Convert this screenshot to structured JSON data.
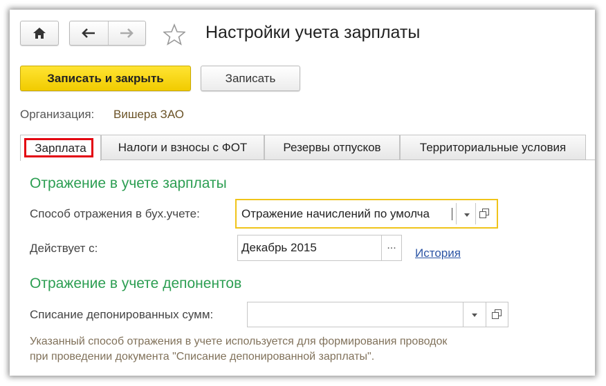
{
  "window": {
    "title": "Настройки учета зарплаты"
  },
  "toolbar": {
    "save_close_label": "Записать и закрыть",
    "save_label": "Записать"
  },
  "organization": {
    "label": "Организация:",
    "value": "Вишера ЗАО"
  },
  "tabs": [
    {
      "label": "Зарплата",
      "active": true
    },
    {
      "label": "Налоги и взносы с ФОТ",
      "active": false
    },
    {
      "label": "Резервы отпусков",
      "active": false
    },
    {
      "label": "Территориальные условия",
      "active": false
    }
  ],
  "salary_section": {
    "title": "Отражение в учете зарплаты",
    "method_label": "Способ отражения в бух.учете:",
    "method_value": "Отражение начислений по умолча",
    "effective_label": "Действует с:",
    "effective_value": "Декабрь 2015",
    "history_link": "История"
  },
  "deponent_section": {
    "title": "Отражение в учете депонентов",
    "writeoff_label": "Списание депонированных сумм:",
    "writeoff_value": "",
    "hint_line1": "Указанный способ отражения в учете используется для формирования проводок",
    "hint_line2": "при проведении документа \"Списание депонированной зарплаты\"."
  },
  "colors": {
    "primary_button": "#f5d20f",
    "section_title": "#2c9e52",
    "focus_border": "#f0c419",
    "highlight_box": "#e3000f",
    "link": "#2b54a4"
  }
}
